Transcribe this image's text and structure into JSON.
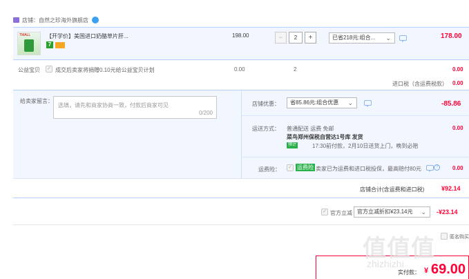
{
  "shop": {
    "label": "店铺：",
    "name": "自然之珍海外旗舰店"
  },
  "item": {
    "title": "【开学价】美国进口奶酪草片肝...",
    "badge_text": "7",
    "thumb_text": "TMALL",
    "unit_price": "198.00",
    "quantity": "2",
    "discount_select": "已省218元:组合...",
    "subtotal": "178.00",
    "minus": "−",
    "plus": "+"
  },
  "charity": {
    "label": "公益宝贝",
    "text": "成交后卖家将捐赠0.10元给公益宝贝计划",
    "price": "0.00",
    "qty": "2",
    "amount": "0.00"
  },
  "import_tax": {
    "label": "进口税（含运费税款）",
    "amount": "0.00"
  },
  "message": {
    "label": "给卖家留言：",
    "placeholder": "选填，请先和商家协商一致，付款后商家可见",
    "counter": "0/200"
  },
  "shop_discount": {
    "label": "店铺优惠：",
    "select": "省85.86元:组合优惠",
    "amount": "-85.86"
  },
  "shipping": {
    "label": "运送方式：",
    "line1": "普通配送 运费 免邮",
    "line2": "菜鸟郑州保税自营达1号库  发货",
    "tag": "预计",
    "line3": "17:30前付款，2月10日送货上门，晚到必赔",
    "amount": "0.00"
  },
  "insurance": {
    "label": "运费险：",
    "tag": "运费险",
    "text": "卖家已为运费和进口税投保，最高赔付80元",
    "amount": "0.00"
  },
  "shop_total": {
    "label": "店铺合计(含运费和进口税)",
    "amount": "¥92.14"
  },
  "official": {
    "label": "官方立减",
    "select": "官方立减折扣¥23.14元",
    "amount": "-¥23.14"
  },
  "anon": {
    "label": "匿名购买"
  },
  "actual": {
    "label": "实付款：",
    "currency": "¥",
    "amount": "69.00"
  },
  "watermark": {
    "text": "值值值",
    "sub": "zhizhizhi"
  },
  "colors": {
    "accent": "#ff0036",
    "blue_bg": "#f2f7ff",
    "border": "#b2d1ff"
  }
}
